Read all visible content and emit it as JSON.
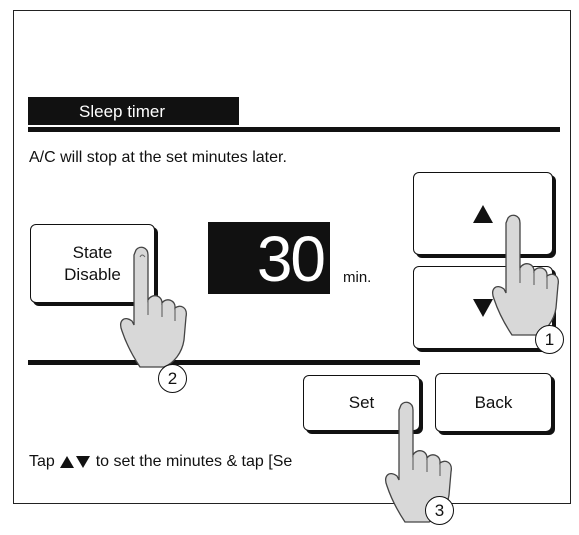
{
  "screen": {
    "title": "Sleep timer",
    "description": "A/C will stop at the set minutes later."
  },
  "state_button": {
    "line1": "State",
    "line2": "Disable"
  },
  "timer": {
    "value": "30",
    "unit": "min."
  },
  "arrows": {
    "up_icon": "up-triangle-icon",
    "down_icon": "down-triangle-icon"
  },
  "actions": {
    "set_label": "Set",
    "back_label": "Back"
  },
  "footer": {
    "prefix": "Tap",
    "text": "to set the minutes & tap [Se"
  },
  "callouts": [
    "1",
    "2",
    "3"
  ],
  "colors": {
    "ink": "#111111",
    "background": "#ffffff"
  }
}
